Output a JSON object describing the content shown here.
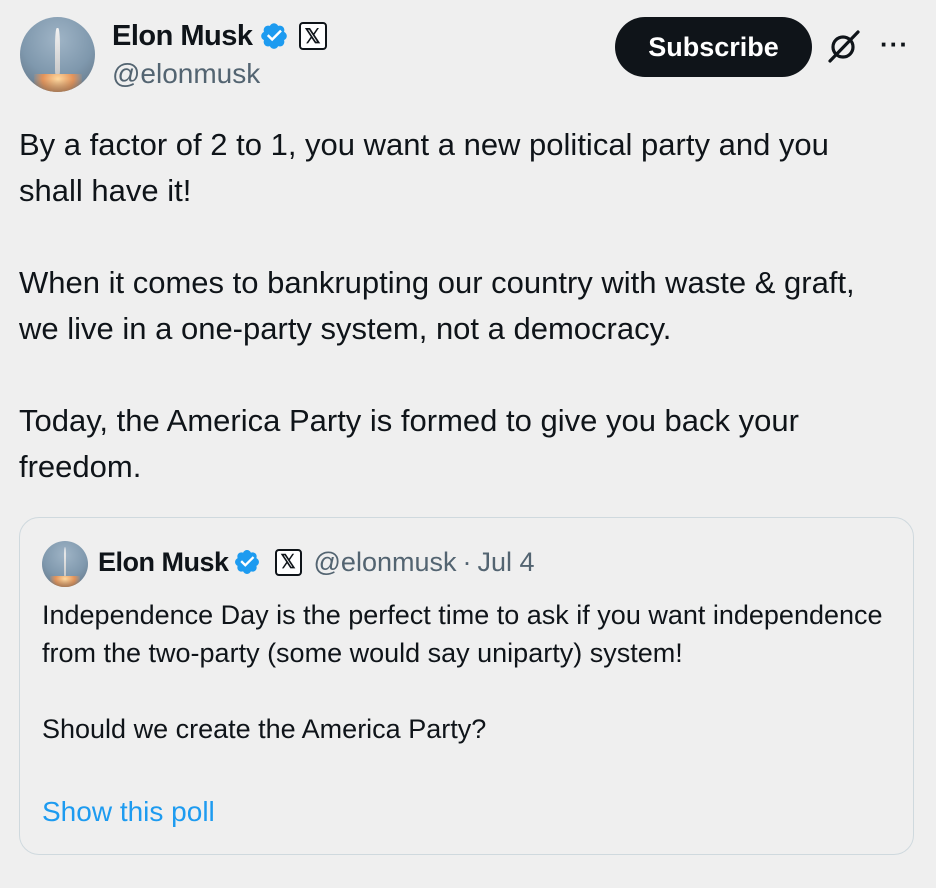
{
  "author": {
    "name": "Elon Musk",
    "handle": "@elonmusk",
    "verified_icon": "verified-badge-icon",
    "affiliate_icon": "x-logo-icon"
  },
  "actions": {
    "subscribe_label": "Subscribe",
    "grok_icon": "grok-icon",
    "more_icon": "more-options-icon",
    "more_glyph": "···"
  },
  "tweet": {
    "paragraphs": [
      "By a factor of 2 to 1, you want a new political party and you\nshall have it!",
      "When it comes to bankrupting our country with waste & graft,\nwe live in a one-party system, not a democracy.",
      "Today, the America Party is formed to give you back your\nfreedom."
    ]
  },
  "quote": {
    "name": "Elon Musk",
    "handle": "@elonmusk",
    "separator": "·",
    "date": "Jul 4",
    "paragraphs": [
      "Independence Day is the perfect time to ask if you want independence from the two-party (some would say uniparty) system!",
      "Should we create the America Party?"
    ],
    "poll_link": "Show this poll"
  },
  "colors": {
    "background": "#efefef",
    "text": "#0f1419",
    "secondary_text": "#536471",
    "link": "#1d9bf0",
    "verified": "#1d9bf0",
    "button_bg": "#0f1419"
  }
}
